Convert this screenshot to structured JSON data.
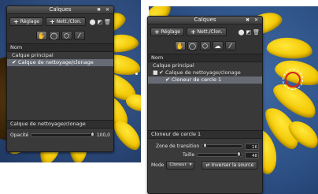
{
  "colors": {
    "panel_bg": "#3a3a3a",
    "selection": "#666b74",
    "sky": "#2c4a7a",
    "petal": "#f2c400",
    "circle": "#d81e1e"
  },
  "left_panel": {
    "title": "Calques",
    "titlebar_icons": "✖ ✕",
    "toolbar": {
      "adjust_label": "Réglage",
      "clone_label": "Nett./Clon.",
      "icons": [
        "mask-icon",
        "gradient-mask-icon",
        "trash-icon"
      ]
    },
    "tools": [
      "hand-icon",
      "circle-icon",
      "polygon-icon",
      "brush-icon"
    ],
    "list": {
      "header": "Nom",
      "rows": [
        {
          "label": "Calque principal",
          "checked": false,
          "selected": false
        },
        {
          "label": "Calque de nettoyage/clonage",
          "checked": true,
          "selected": true
        }
      ]
    },
    "footer": {
      "title": "Calque de nettoyage/clonage",
      "opacity_label": "Opacité",
      "opacity_value": "100,0",
      "opacity_fraction": 1.0
    }
  },
  "right_panel": {
    "title": "Calques",
    "titlebar_icons": "✖ ✕",
    "toolbar": {
      "adjust_label": "Réglage",
      "clone_label": "Nett./Clon.",
      "icons": [
        "mask-icon",
        "gradient-mask-icon",
        "trash-icon"
      ]
    },
    "tools": [
      "hand-icon",
      "circle-icon",
      "polygon-icon",
      "lasso-icon",
      "brush-icon"
    ],
    "list": {
      "header": "Nom",
      "rows": [
        {
          "label": "Calque principal",
          "checked": false,
          "selected": false
        },
        {
          "label": "Calque de nettoyage/clonage",
          "checked": true,
          "selected": false
        },
        {
          "label": "Cloneur de cercle 1",
          "checked": true,
          "selected": true
        }
      ]
    },
    "footer": {
      "title": "Cloneur de cercle 1",
      "transition_label": "Zone de transition",
      "transition_value": "16",
      "transition_fraction": 0.05,
      "size_label": "Taille",
      "size_value": "48",
      "size_fraction": 0.93,
      "mode_label": "Mode",
      "mode_value": "Cloneur",
      "swap_label": "Inverser la source"
    }
  }
}
